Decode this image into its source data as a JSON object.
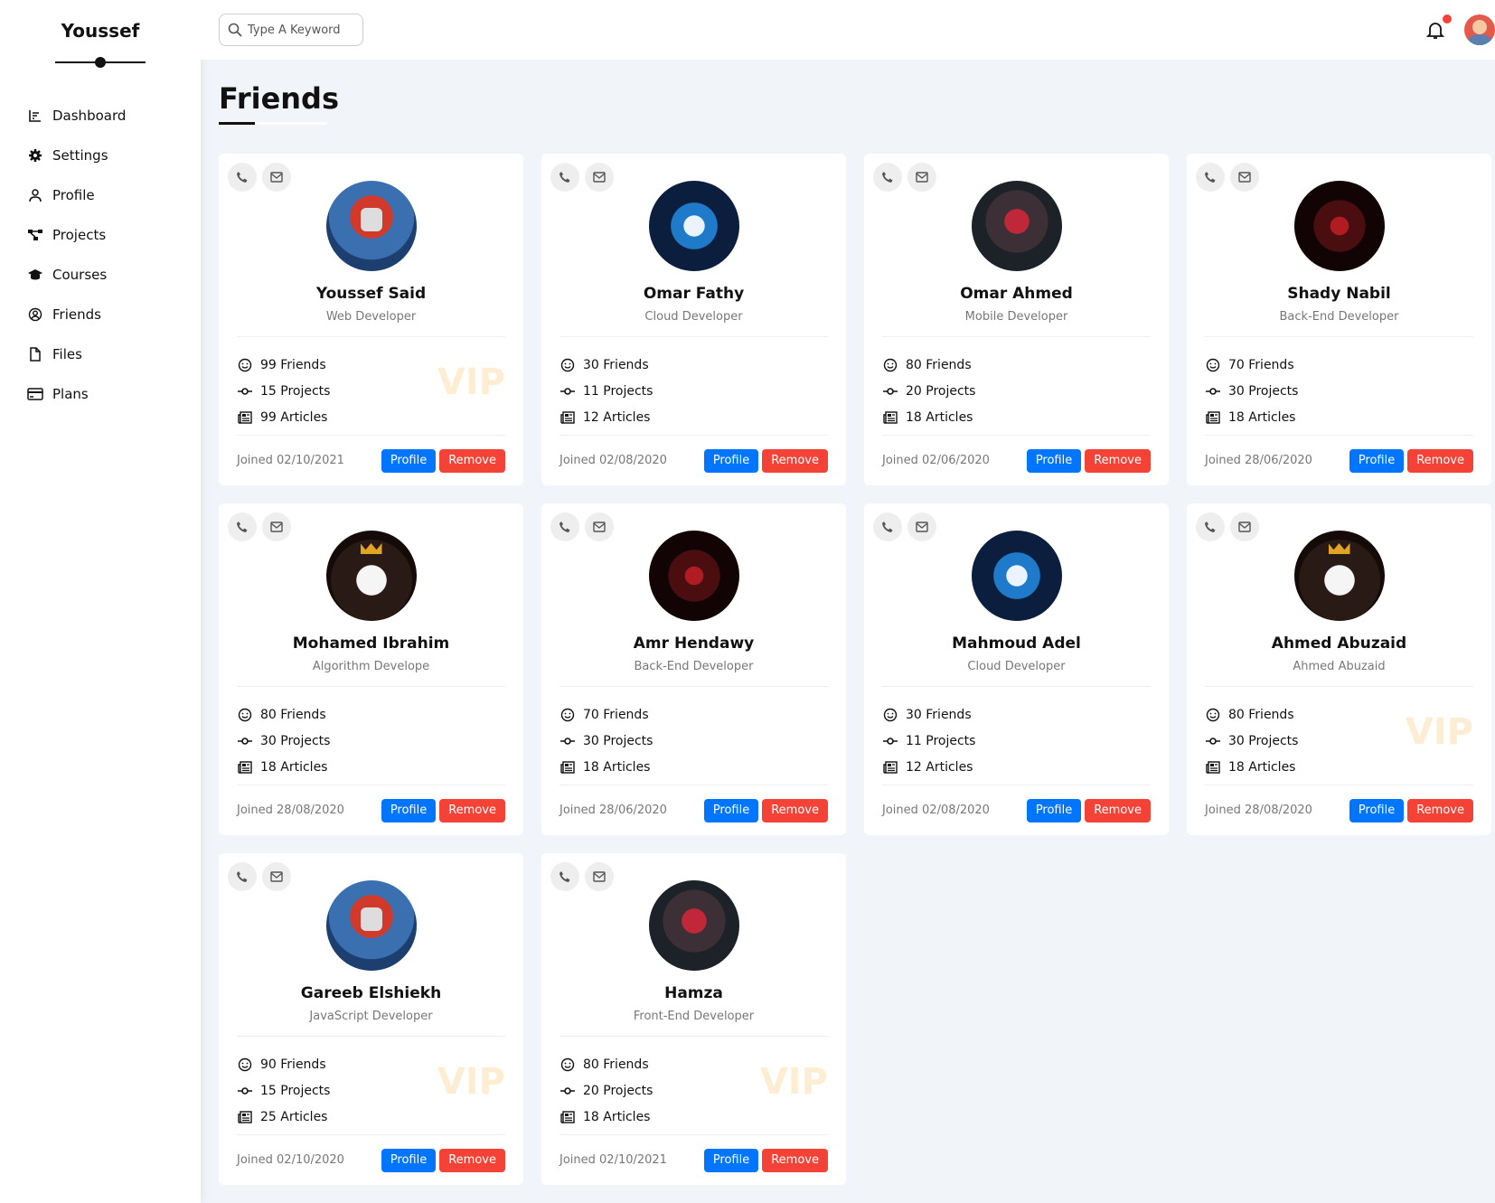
{
  "sidebar": {
    "brand": "Youssef",
    "items": [
      {
        "label": "Dashboard",
        "icon": "dashboard-chart-icon"
      },
      {
        "label": "Settings",
        "icon": "gear-icon"
      },
      {
        "label": "Profile",
        "icon": "user-icon"
      },
      {
        "label": "Projects",
        "icon": "diagram-icon"
      },
      {
        "label": "Courses",
        "icon": "graduation-cap-icon"
      },
      {
        "label": "Friends",
        "icon": "user-circle-icon"
      },
      {
        "label": "Files",
        "icon": "file-icon"
      },
      {
        "label": "Plans",
        "icon": "credit-card-icon"
      }
    ]
  },
  "topbar": {
    "search_placeholder": "Type A Keyword"
  },
  "page": {
    "title": "Friends"
  },
  "buttons": {
    "profile": "Profile",
    "remove": "Remove"
  },
  "colors": {
    "primary": "#0075ff",
    "danger": "#f44336",
    "background": "#f1f5f9",
    "vip": "#f59e0b"
  },
  "friends": [
    {
      "name": "Youssef Said",
      "role": "Web Developer",
      "friends": "99 Friends",
      "projects": "15 Projects",
      "articles": "99 Articles",
      "joined": "Joined 02/10/2021",
      "vip": "VIP",
      "avatar": "red"
    },
    {
      "name": "Omar Fathy",
      "role": "Cloud Developer",
      "friends": "30 Friends",
      "projects": "11 Projects",
      "articles": "12 Articles",
      "joined": "Joined 02/08/2020",
      "vip": "",
      "avatar": "blue"
    },
    {
      "name": "Omar Ahmed",
      "role": "Mobile Developer",
      "friends": "80 Friends",
      "projects": "20 Projects",
      "articles": "18 Articles",
      "joined": "Joined 02/06/2020",
      "vip": "",
      "avatar": "dark"
    },
    {
      "name": "Shady Nabil",
      "role": "Back-End Developer",
      "friends": "70 Friends",
      "projects": "30 Projects",
      "articles": "18 Articles",
      "joined": "Joined 28/06/2020",
      "vip": "",
      "avatar": "ninja"
    },
    {
      "name": "Mohamed Ibrahim",
      "role": "Algorithm Develope",
      "friends": "80 Friends",
      "projects": "30 Projects",
      "articles": "18 Articles",
      "joined": "Joined 28/08/2020",
      "vip": "",
      "avatar": "skull"
    },
    {
      "name": "Amr Hendawy",
      "role": "Back-End Developer",
      "friends": "70 Friends",
      "projects": "30 Projects",
      "articles": "18 Articles",
      "joined": "Joined 28/06/2020",
      "vip": "",
      "avatar": "ninja"
    },
    {
      "name": "Mahmoud Adel",
      "role": "Cloud Developer",
      "friends": "30 Friends",
      "projects": "11 Projects",
      "articles": "12 Articles",
      "joined": "Joined 02/08/2020",
      "vip": "",
      "avatar": "blue"
    },
    {
      "name": "Ahmed Abuzaid",
      "role": "Ahmed Abuzaid",
      "friends": "80 Friends",
      "projects": "30 Projects",
      "articles": "18 Articles",
      "joined": "Joined 28/08/2020",
      "vip": "VIP",
      "avatar": "skull"
    },
    {
      "name": "Gareeb Elshiekh",
      "role": "JavaScript Developer",
      "friends": "90 Friends",
      "projects": "15 Projects",
      "articles": "25 Articles",
      "joined": "Joined 02/10/2020",
      "vip": "VIP",
      "avatar": "red"
    },
    {
      "name": "Hamza",
      "role": "Front-End Developer",
      "friends": "80 Friends",
      "projects": "20 Projects",
      "articles": "18 Articles",
      "joined": "Joined 02/10/2021",
      "vip": "VIP",
      "avatar": "dark"
    }
  ]
}
